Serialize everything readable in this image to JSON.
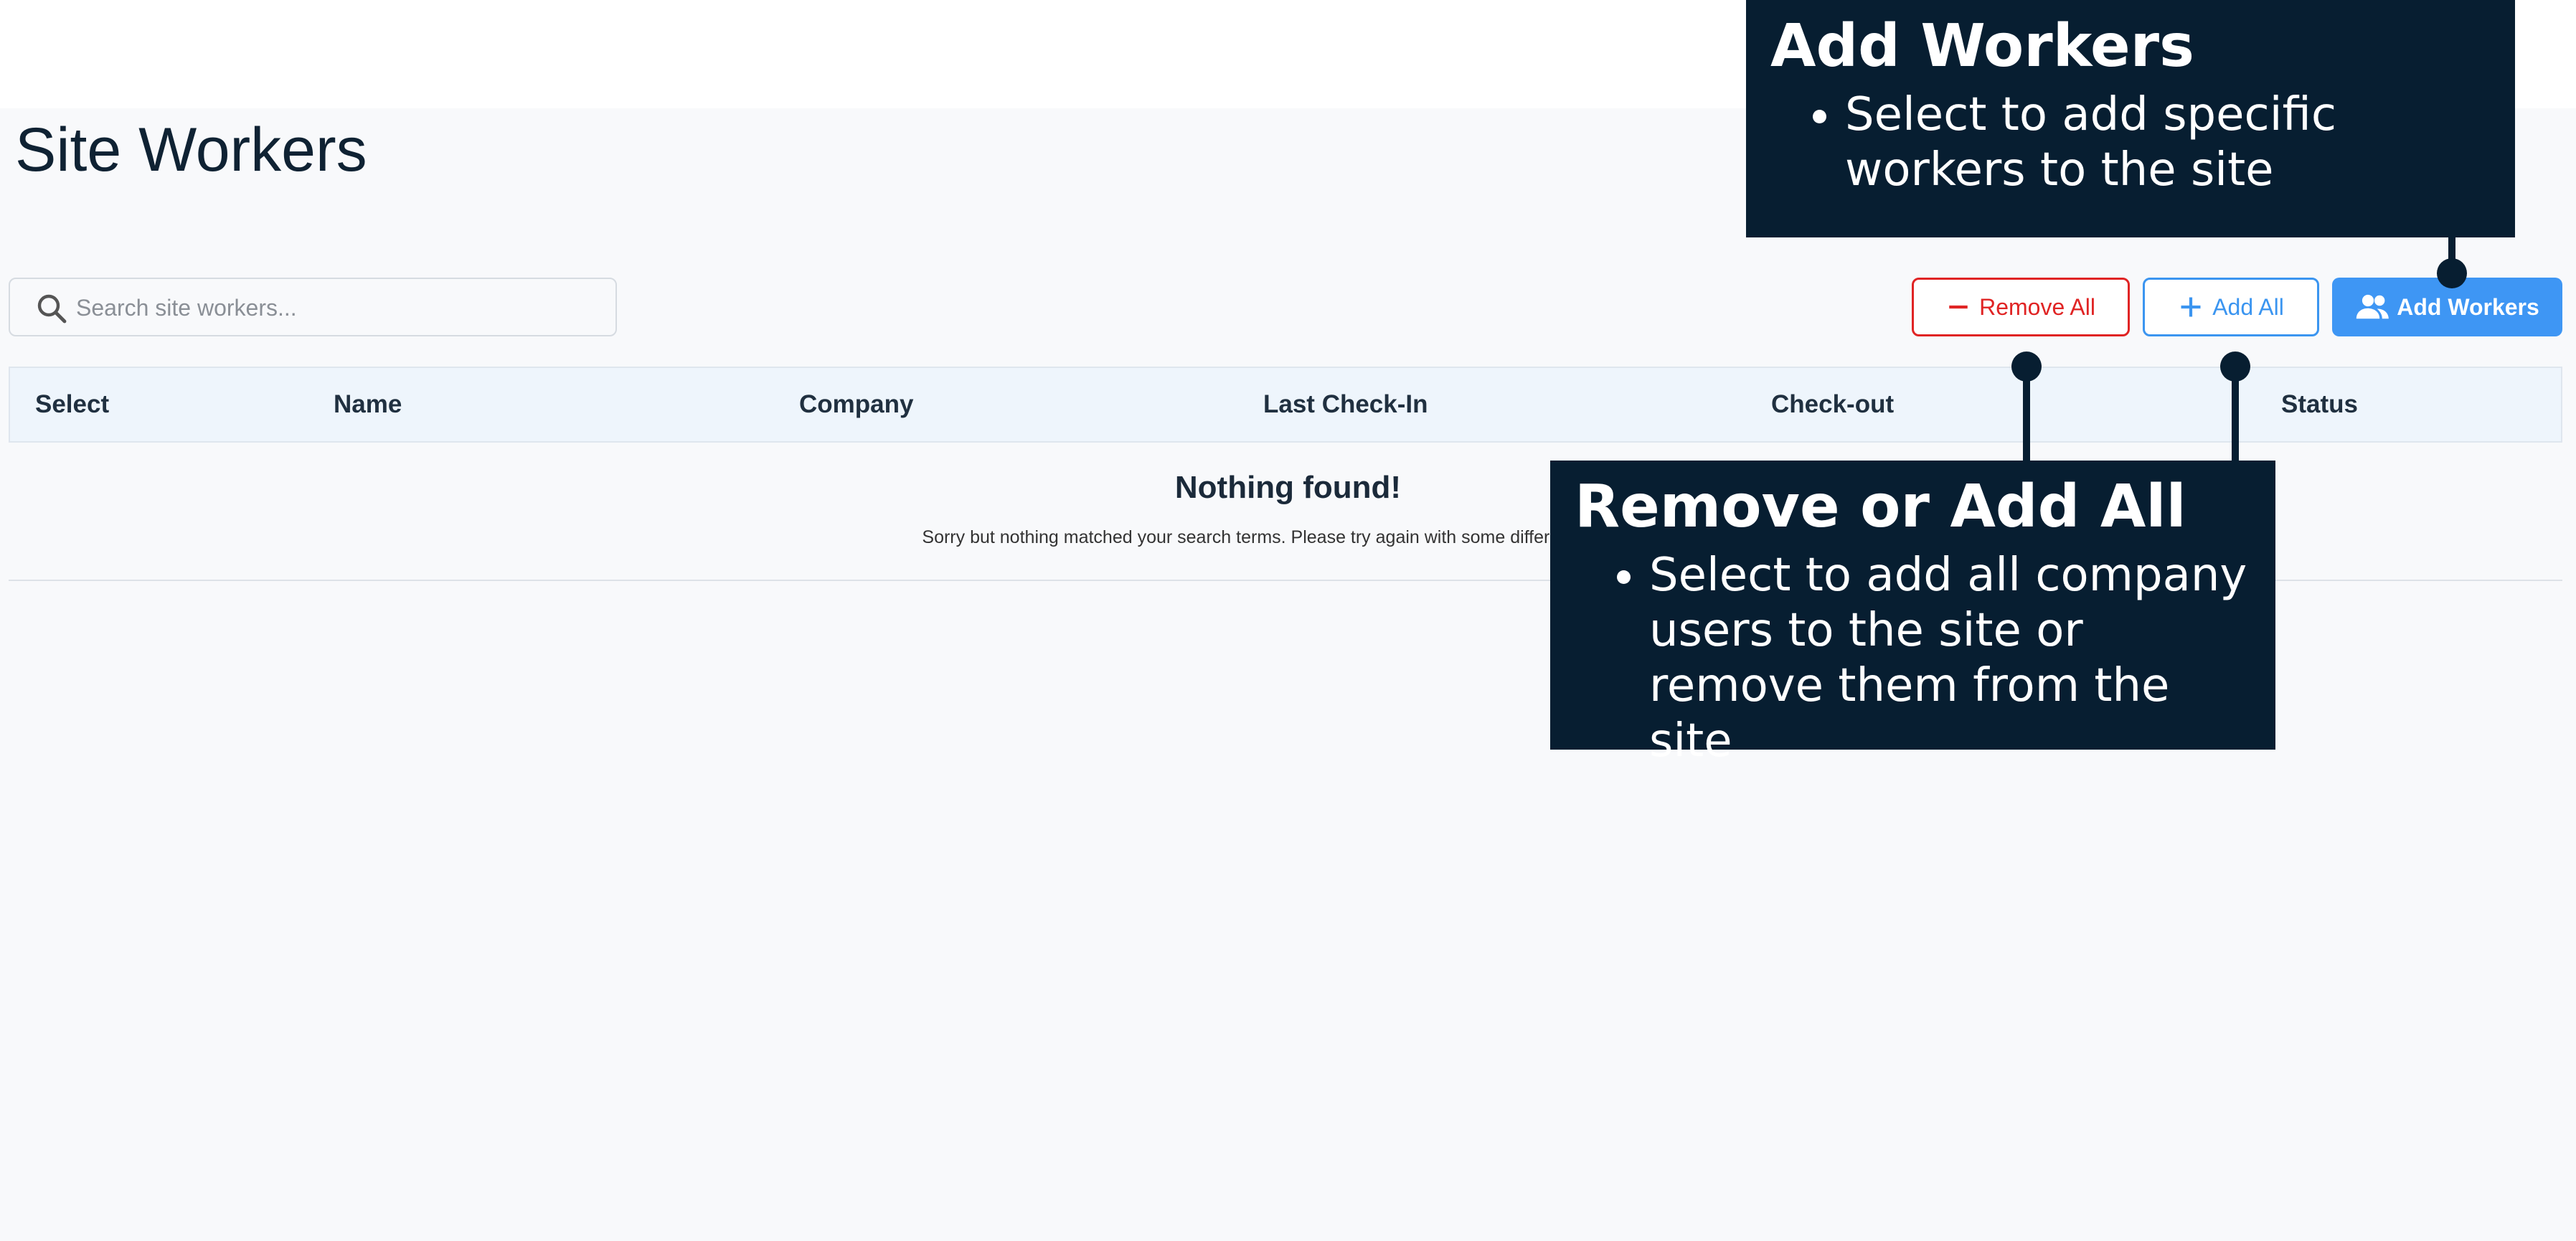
{
  "page": {
    "title": "Site Workers"
  },
  "search": {
    "placeholder": "Search site workers..."
  },
  "toolbar": {
    "remove_all_label": "Remove All",
    "add_all_label": "Add All",
    "add_workers_label": "Add Workers"
  },
  "table": {
    "columns": [
      "Select",
      "Name",
      "Company",
      "Last Check-In",
      "Check-out",
      "Status"
    ],
    "rows": []
  },
  "empty_state": {
    "title": "Nothing found!",
    "message": "Sorry but nothing matched your search terms. Please try again with some different keywords."
  },
  "callouts": {
    "add_workers": {
      "title": "Add Workers",
      "bullet": "Select to add specific workers to the site"
    },
    "remove_or_add_all": {
      "title": "Remove or Add All",
      "bullet": "Select to add all company users to the site or remove them from the site"
    }
  },
  "colors": {
    "remove": "#e02424",
    "add_all": "#3b95f0",
    "add_workers": "#3e96f4",
    "callout_bg": "#071e31",
    "header_bg": "#eef5fc"
  },
  "icons": {
    "search": "search-icon",
    "remove": "minus-icon",
    "add_all": "plus-icon",
    "add_workers": "group-add-icon"
  }
}
